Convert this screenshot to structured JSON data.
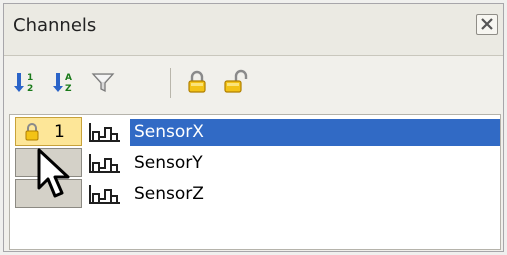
{
  "panel": {
    "title": "Channels"
  },
  "toolbar": {
    "buttons": [
      {
        "name": "sort-numeric-icon",
        "label": "1 2"
      },
      {
        "name": "sort-alpha-icon",
        "label": "A Z"
      },
      {
        "name": "filter-icon"
      },
      {
        "name": "lock-closed-icon"
      },
      {
        "name": "lock-open-icon"
      }
    ]
  },
  "channels": [
    {
      "index": "1",
      "locked": true,
      "name": "SensorX",
      "selected": true
    },
    {
      "index": "",
      "locked": false,
      "name": "SensorY",
      "selected": false
    },
    {
      "index": "",
      "locked": false,
      "name": "SensorZ",
      "selected": false
    }
  ],
  "colors": {
    "selection": "#316ac5",
    "lock_cell": "#fde698",
    "sort_arrow": "#2b64c8",
    "lock_gold": "#e8b400"
  }
}
